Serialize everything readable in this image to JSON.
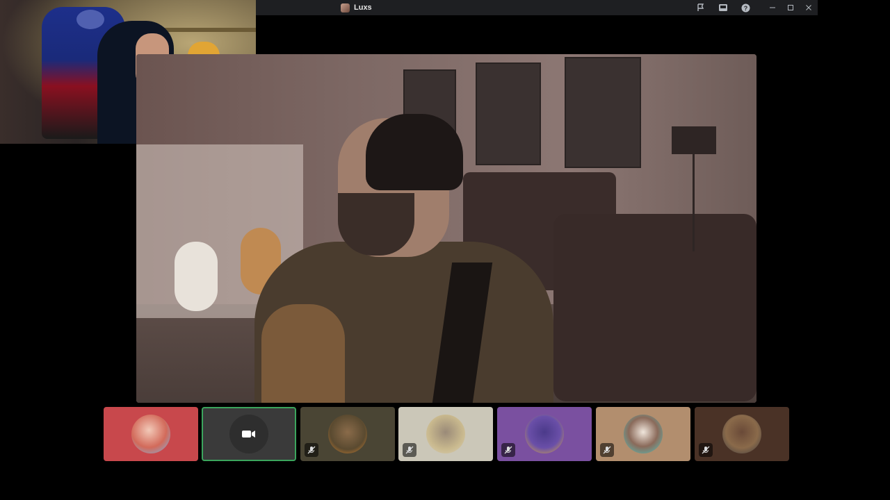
{
  "window": {
    "title": "Luxs",
    "icons": [
      "flag-icon",
      "inbox-icon",
      "help-icon"
    ],
    "controls": [
      "minimize-icon",
      "maximize-icon",
      "close-icon"
    ]
  },
  "colors": {
    "titlebar": "#1e1f22",
    "speaking_ring": "#3ba55d",
    "tile_1": "#c8484c",
    "tile_2": "#3a3a3a",
    "tile_3": "#4a4534",
    "tile_4": "#cbc7b8",
    "tile_5": "#7a50a0",
    "tile_6": "#b28e6e",
    "tile_7": "#4a3226"
  },
  "participants": [
    {
      "id": "p1",
      "muted": false,
      "camera_off": false,
      "speaking": false
    },
    {
      "id": "p2",
      "muted": false,
      "camera_off": true,
      "speaking": true
    },
    {
      "id": "p3",
      "muted": true,
      "camera_off": false,
      "speaking": false
    },
    {
      "id": "p4",
      "muted": true,
      "camera_off": false,
      "speaking": false
    },
    {
      "id": "p5",
      "muted": true,
      "camera_off": false,
      "speaking": false
    },
    {
      "id": "p6",
      "muted": true,
      "camera_off": false,
      "speaking": false
    },
    {
      "id": "p7",
      "muted": true,
      "camera_off": false,
      "speaking": false
    }
  ]
}
